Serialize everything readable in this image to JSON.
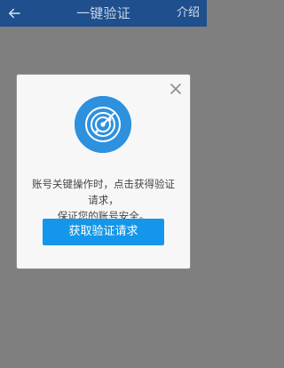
{
  "app_bar": {
    "title": "一键验证",
    "about_label": "介绍",
    "back_icon": "back-arrow-icon"
  },
  "dialog": {
    "close_icon": "close-icon",
    "hero_icon": "radar-scan-icon",
    "message_line_1": "账号关键操作时，点击获得验证请求，",
    "message_line_2": "保证您的账号安全。",
    "button_label": "获取验证请求"
  },
  "colors": {
    "app_bar": "#1f4f8d",
    "overlay": "#7f7f7f",
    "dialog_bg": "#f7f7f7",
    "accent": "#2d91de",
    "button": "#1497ea"
  }
}
